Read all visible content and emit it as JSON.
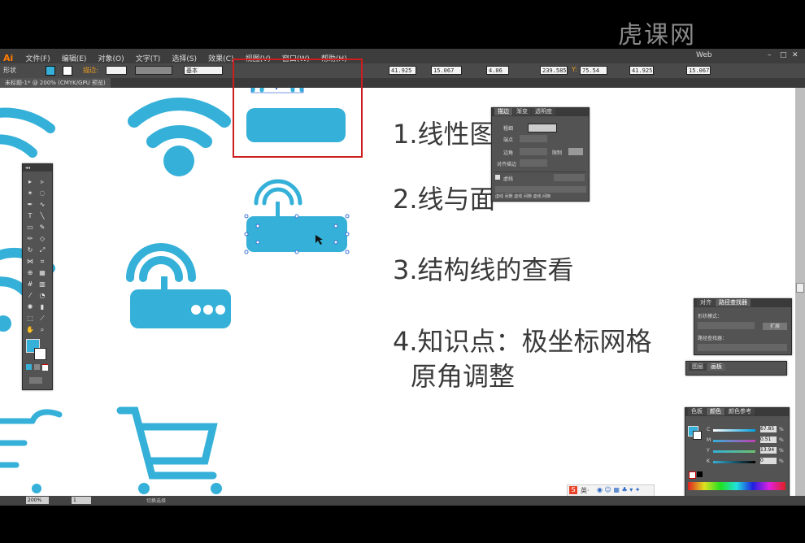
{
  "watermark": "虎课网",
  "menubar": {
    "logo": "Ai",
    "items": [
      "文件(F)",
      "编辑(E)",
      "对象(O)",
      "文字(T)",
      "选择(S)",
      "效果(C)",
      "视图(V)",
      "窗口(W)",
      "帮助(H)"
    ],
    "workspace": "Web"
  },
  "control_bar": {
    "mode_label": "形状",
    "stroke_label": "描边:",
    "stroke_style": "基本",
    "x_value": "41.925 mm",
    "w_value": "15.067 mm",
    "corner_value": "4.06 mm",
    "x2_value": "239.585",
    "y_label": "Y:",
    "y_value": "75.54 mm",
    "w2_value": "41.925",
    "h_value": "15.067 mm"
  },
  "document_tab": "未标题-1* @ 200% (CMYK/GPU 预览)",
  "headings": [
    "1.线性图",
    "2.线与面",
    "3.结构线的查看",
    "4.知识点：极坐标网格",
    "原角调整"
  ],
  "stroke_panel": {
    "tabs": [
      "描边",
      "渐变",
      "透明度"
    ],
    "weight_label": "粗细",
    "cap_label": "端点",
    "corner_label": "边角",
    "limit_label": "限制",
    "align_label": "对齐描边",
    "dashed_label": "虚线",
    "dash_fields": [
      "虚线",
      "间隙",
      "虚线",
      "间隙",
      "虚线",
      "间隙"
    ]
  },
  "pathfinder_panel": {
    "tabs": [
      "对齐",
      "路径查找器"
    ],
    "shape_modes_label": "形状模式：",
    "expand_label": "扩展",
    "pathfinders_label": "路径查找器："
  },
  "layers_panel": {
    "tabs": [
      "图层",
      "画板"
    ]
  },
  "color_panel": {
    "tabs": [
      "色板",
      "颜色",
      "颜色参考"
    ],
    "channels": [
      {
        "label": "C",
        "value": "67.85",
        "unit": "%"
      },
      {
        "label": "M",
        "value": "0.51",
        "unit": "%"
      },
      {
        "label": "Y",
        "value": "13.94",
        "unit": "%"
      },
      {
        "label": "K",
        "value": "0",
        "unit": "%"
      }
    ]
  },
  "status_bar": {
    "zoom": "200%",
    "artboard": "1",
    "tool_status": "切换选择"
  },
  "colors": {
    "accent_blue": "#35b0d8",
    "highlight_red": "#cc1e1e"
  }
}
